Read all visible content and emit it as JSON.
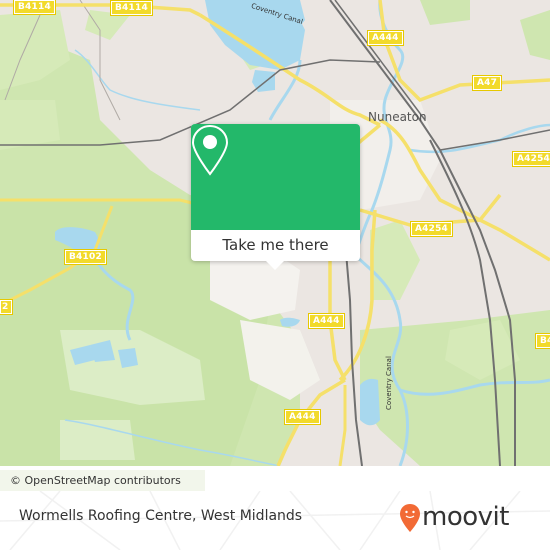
{
  "map": {
    "place_labels": [
      {
        "id": "nuneaton",
        "text": "Nuneaton"
      }
    ],
    "water_labels": [
      {
        "id": "coventry-canal-north",
        "text": "Coventry Canal"
      },
      {
        "id": "coventry-canal-south",
        "text": "Coventry Canal"
      }
    ],
    "road_labels": [
      {
        "id": "b4114-a",
        "text": "B4114"
      },
      {
        "id": "b4114-b",
        "text": "B4114"
      },
      {
        "id": "a444-north",
        "text": "A444"
      },
      {
        "id": "a47",
        "text": "A47"
      },
      {
        "id": "a4254-east",
        "text": "A4254"
      },
      {
        "id": "a4254-mid",
        "text": "A4254"
      },
      {
        "id": "b4102",
        "text": "B4102"
      },
      {
        "id": "b4102-edge",
        "text": "2"
      },
      {
        "id": "a444-mid",
        "text": "A444"
      },
      {
        "id": "b4-edge",
        "text": "B4"
      },
      {
        "id": "a444-south",
        "text": "A444"
      },
      {
        "id": "a444-bottom",
        "text": "A444"
      }
    ],
    "colors": {
      "land": "#ebe6e2",
      "park": "#cfe6b0",
      "park_light": "#dcedc6",
      "water": "#a8d8ee",
      "road_major": "#f5e06a",
      "rail": "#707070"
    },
    "attribution": "© OpenStreetMap contributors"
  },
  "popup": {
    "button_label": "Take me there",
    "pin_icon": "map-pin-icon",
    "color": "#23b86a"
  },
  "footer": {
    "place_title": "Wormells Roofing Centre, West Midlands",
    "logo_text": "moovit",
    "logo_color": "#f26a35"
  }
}
